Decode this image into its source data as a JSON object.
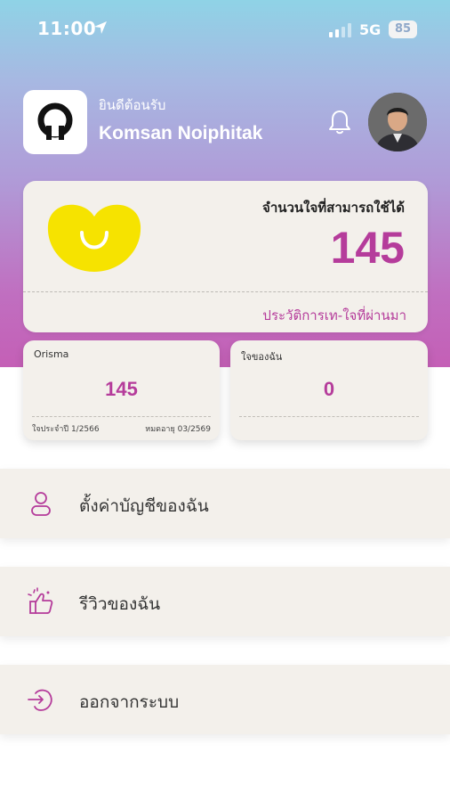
{
  "status_bar": {
    "time": "11:00",
    "network": "5G",
    "battery": "85"
  },
  "header": {
    "greeting": "ยินดีต้อนรับ",
    "user_name": "Komsan Noiphitak"
  },
  "points_card": {
    "label": "จำนวนใจที่สามารถใช้ได้",
    "value": "145",
    "history_link": "ประวัติการเท-ใจที่ผ่านมา"
  },
  "cards": [
    {
      "label": "Orisma",
      "value": "145",
      "foot_left": "ใจประจำปี 1/2566",
      "foot_right": "หมดอายุ 03/2569"
    },
    {
      "label": "ใจของฉัน",
      "value": "0"
    }
  ],
  "menu": [
    {
      "label": "ตั้งค่าบัญชีของฉัน",
      "icon": "user-icon"
    },
    {
      "label": "รีวิวของฉัน",
      "icon": "thumbs-up-icon"
    },
    {
      "label": "ออกจากระบบ",
      "icon": "logout-icon"
    }
  ],
  "colors": {
    "accent": "#b53c9b",
    "card_bg": "#f3f0eb",
    "heart_yellow": "#f6e300"
  }
}
